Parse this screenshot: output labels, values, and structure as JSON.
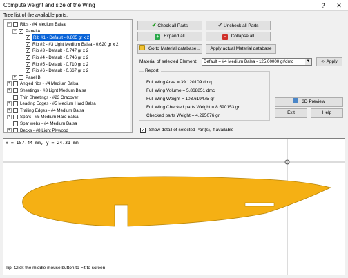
{
  "window": {
    "title": "Compute weight and size of the Wing",
    "help_btn": "?",
    "close_btn": "✕"
  },
  "tree": {
    "label": "Tree list of the available parts:",
    "items": [
      {
        "label": "Ribs - #4 Medium Balsa",
        "checked": false,
        "expand": "−"
      },
      {
        "label": "Panel A",
        "checked": true,
        "expand": "−"
      },
      {
        "label": "Rib #1 - Default - 0.805 gr x 2",
        "checked": true,
        "selected": true
      },
      {
        "label": "Rib #2 - #3 Light Medium Balsa - 0.620 gr x 2",
        "checked": true
      },
      {
        "label": "Rib #3 - Default - 0.747 gr x 2",
        "checked": true
      },
      {
        "label": "Rib #4 - Default - 0.746 gr x 2",
        "checked": true
      },
      {
        "label": "Rib #5 - Default - 0.710 gr x 2",
        "checked": true
      },
      {
        "label": "Rib #6 - Default - 0.667 gr x 2",
        "checked": true
      },
      {
        "label": "Panel B",
        "checked": false,
        "expand": "+"
      },
      {
        "label": "Angled ribs - #4 Medium Balsa",
        "checked": false,
        "expand": "+"
      },
      {
        "label": "Sheetings - #3 Light Medium Balsa",
        "checked": false,
        "expand": "+"
      },
      {
        "label": "Thin Sheetings - #23 Oracover",
        "checked": false
      },
      {
        "label": "Leading Edges - #5 Medium Hard Balsa",
        "checked": false,
        "expand": "+"
      },
      {
        "label": "Trailing Edges - #4 Medium Balsa",
        "checked": false,
        "expand": "+"
      },
      {
        "label": "Spars - #5 Medium Hard Balsa",
        "checked": false,
        "expand": "+"
      },
      {
        "label": "Spar webs - #4 Medium Balsa",
        "checked": false
      },
      {
        "label": "Decks - #8 Light Plywood",
        "checked": false,
        "expand": "+"
      }
    ]
  },
  "buttons": {
    "check_all": "Check all Parts",
    "uncheck_all": "Uncheck all Parts",
    "expand_all": "Expand all",
    "collapse_all": "Collapse all",
    "goto_db": "Go to Material database...",
    "apply_db": "Apply actual Material database",
    "apply": "<- Apply",
    "preview": "3D Preview",
    "exit": "Exit",
    "help": "Help"
  },
  "material": {
    "label": "Material of selected Element:",
    "value": "Default = #4 Medium Balsa - 125.00000 gr/dmc"
  },
  "report": {
    "title": "Report:",
    "lines": [
      "Full Wing Area = 39.120109 dmq",
      "Full Wing Volume = 5.868851 dmc",
      "Full Wing Weight = 103.619475 gr",
      "Full Wing Checked parts Weight = 8.590153 gr",
      "Checked parts Weight = 4.295076 gr"
    ]
  },
  "show_detail": {
    "label": "Show detail of selected Part(s), if available",
    "checked": true
  },
  "canvas": {
    "coords": "x = 157.44 mm, y = 24.31 mm",
    "tip": "Tip: Click the middle mouse button to Fit to screen"
  },
  "colors": {
    "rib_fill": "#f5b014",
    "selection": "#0a64d8"
  }
}
